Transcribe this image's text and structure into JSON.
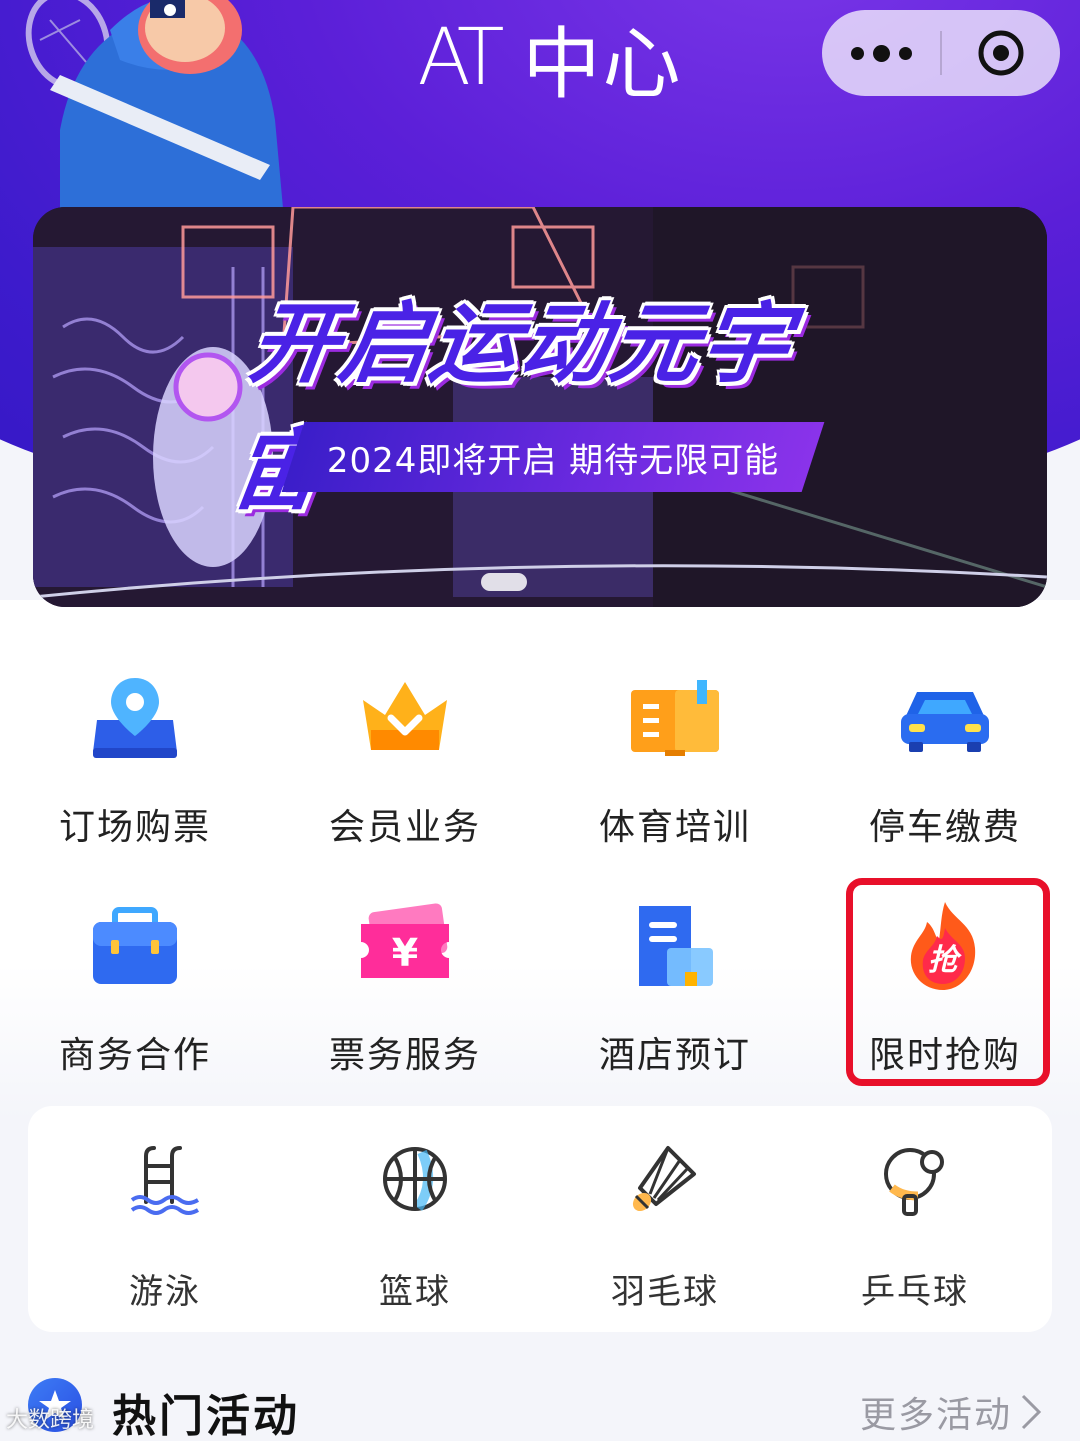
{
  "header": {
    "logo_at": "AT",
    "logo_cn": "中心"
  },
  "capsule": {
    "more_icon": "more-dots-icon",
    "close_icon": "target-circle-icon"
  },
  "banner": {
    "title": "开启运动元宇宙",
    "subtitle": "2024即将开启 期待无限可能",
    "slides_total": 1,
    "active_slide": 1
  },
  "services": [
    {
      "label": "订场购票",
      "icon": "location-ticket-icon"
    },
    {
      "label": "会员业务",
      "icon": "crown-icon"
    },
    {
      "label": "体育培训",
      "icon": "book-icon"
    },
    {
      "label": "停车缴费",
      "icon": "car-icon"
    },
    {
      "label": "商务合作",
      "icon": "briefcase-icon"
    },
    {
      "label": "票务服务",
      "icon": "yuan-ticket-icon"
    },
    {
      "label": "酒店预订",
      "icon": "hotel-document-icon"
    },
    {
      "label": "限时抢购",
      "icon": "flame-grab-icon",
      "badge": "抢"
    }
  ],
  "sports": [
    {
      "label": "游泳",
      "icon": "swimming-pool-icon"
    },
    {
      "label": "篮球",
      "icon": "basketball-icon"
    },
    {
      "label": "羽毛球",
      "icon": "shuttlecock-icon"
    },
    {
      "label": "乒乓球",
      "icon": "ping-pong-icon"
    }
  ],
  "hot": {
    "title": "热门活动",
    "more": "更多活动"
  },
  "watermark": "大数跨境",
  "colors": {
    "brand_purple": "#4a22e6",
    "highlight_red": "#e8102a"
  }
}
